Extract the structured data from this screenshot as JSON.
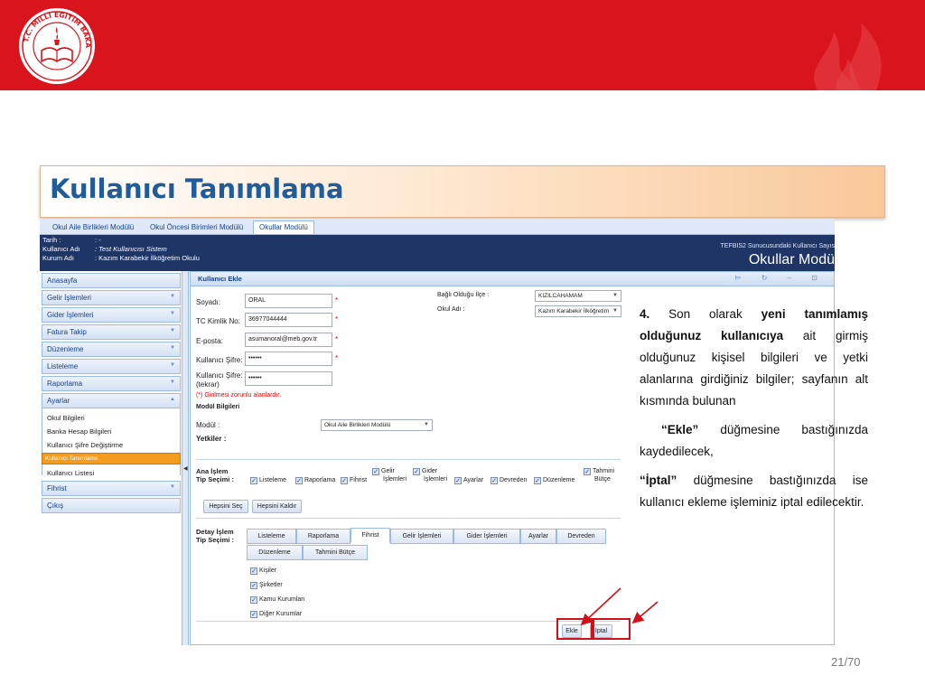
{
  "slide": {
    "title": "Kullanıcı Tanımlama",
    "page": "21/70",
    "logo_text": "T.C. MİLLİ EĞİTİM BAKANLIĞI",
    "colors": {
      "band": "#d9141c",
      "title": "#1f5c99",
      "nav_dark": "#1f3566",
      "highlight": "#f39c1f"
    }
  },
  "app": {
    "tabs": [
      {
        "label": "Okul Aile Birlikleri Modülü"
      },
      {
        "label": "Okul Öncesi Birimleri Modülü"
      },
      {
        "label": "Okullar Modülü"
      }
    ],
    "header": {
      "tarih_label": "Tarih :",
      "tarih_value": ": -",
      "user_label": "Kullanıcı Adı",
      "user_value": ": Test Kullanıcısı Sistem",
      "kurum_label": "Kurum Adı",
      "kurum_value": ": Kazım Karabekir İlköğretim Okulu",
      "right_small": "TEFBIS2 Sunucusundaki Kullanıcı Sayıs",
      "right_big": "Okullar Modü"
    },
    "sidebar": {
      "items": [
        {
          "label": "Anasayfa"
        },
        {
          "label": "Gelir İşlemleri"
        },
        {
          "label": "Gider İşlemleri"
        },
        {
          "label": "Fatura Takip"
        },
        {
          "label": "Düzenleme"
        },
        {
          "label": "Listeleme"
        },
        {
          "label": "Raporlama"
        },
        {
          "label": "Ayarlar"
        }
      ],
      "sub_items": [
        {
          "label": "Okul Bilgileri"
        },
        {
          "label": "Banka Hesap Bilgileri"
        },
        {
          "label": "Kullanıcı Şifre Değiştirme"
        },
        {
          "label": "Kullanıcı Tanımlama"
        },
        {
          "label": "Kullanıcı Listesi"
        }
      ],
      "bottom": [
        {
          "label": "Fihrist"
        },
        {
          "label": "Çıkış"
        }
      ]
    },
    "panel": {
      "title": "Kullanıcı Ekle",
      "controls": "⊨ ↻ – ⊡",
      "soyadi_label": "Soyadı:",
      "soyadi_value": "ORAL",
      "tc_label": "TC Kimlik No:",
      "tc_value": "36977044444",
      "eposta_label": "E-posta:",
      "eposta_value": "asumanoral@meb.gov.tr",
      "sifre_label": "Kullanıcı Şifre:",
      "sifre_value": "••••••",
      "sifre2_label": "Kullanıcı Şifre:",
      "sifre2_label_2": "(tekrar)",
      "sifre2_value": "••••••",
      "required_star": "*",
      "note": "(*) Girilmesi zorunlu alanlardır.",
      "modul_bilgileri": "Modül Bilgileri",
      "modul_label": "Modül :",
      "modul_value": "Okul Aile Birlikleri Modülü",
      "yetkiler_label": "Yetkiler :",
      "ilce_label": "Bağlı Olduğu İlçe :",
      "ilce_value": "KIZILCAHAMAM",
      "okul_label": "Okul Adı :",
      "okul_value": "Kazım Karabekir İlköğretim",
      "ana_islem_label_1": "Ana İşlem",
      "ana_islem_label_2": "Tip Seçimi :",
      "ana_checks": [
        {
          "label": "Listeleme"
        },
        {
          "label": "Raporlama"
        },
        {
          "label": "Fihrist"
        },
        {
          "label": "Gelir",
          "label2": "İşlemleri"
        },
        {
          "label": "Gider",
          "label2": "İşlemleri"
        },
        {
          "label": "Ayarlar"
        },
        {
          "label": "Devreden"
        },
        {
          "label": "Düzenleme"
        },
        {
          "label": "Tahmini",
          "label2": "Bütçe"
        }
      ],
      "check_mark": "✓",
      "select_all": "Hepsini Seç",
      "clear_all": "Hepsini Kaldır",
      "detay_label_1": "Detay İşlem",
      "detay_label_2": "Tip Seçimi :",
      "detay_tabs": [
        {
          "label": "Listeleme"
        },
        {
          "label": "Raporlama"
        },
        {
          "label": "Fihrist"
        },
        {
          "label": "Gelir İşlemleri"
        },
        {
          "label": "Gider İşlemleri"
        },
        {
          "label": "Ayarlar"
        },
        {
          "label": "Devreden"
        },
        {
          "label": "Düzenleme"
        },
        {
          "label": "Tahmini Bütçe"
        }
      ],
      "detay_checks": [
        {
          "label": "Kişiler"
        },
        {
          "label": "Şirketler"
        },
        {
          "label": "Kamu Kurumları"
        },
        {
          "label": "Diğer Kurumlar"
        }
      ],
      "ekle": "Ekle",
      "iptal": "İptal"
    }
  },
  "text": {
    "p1_num": "4.",
    "p1_a": "Son olarak",
    "p1_b": "yeni tanımlamış olduğunuz kullanıcıya",
    "p1_c": "ait girmiş olduğunuz kişisel bilgileri ve yetki alanlarına girdiğiniz bilgiler; sayfanın alt kısmında bulunan",
    "p2_b": "“Ekle”",
    "p2_c": "düğmesine bastığınızda kaydedilecek,",
    "p3_b": "“İptal”",
    "p3_c": "düğmesine bastığınızda ise kullanıcı ekleme işleminiz iptal edilecektir."
  }
}
